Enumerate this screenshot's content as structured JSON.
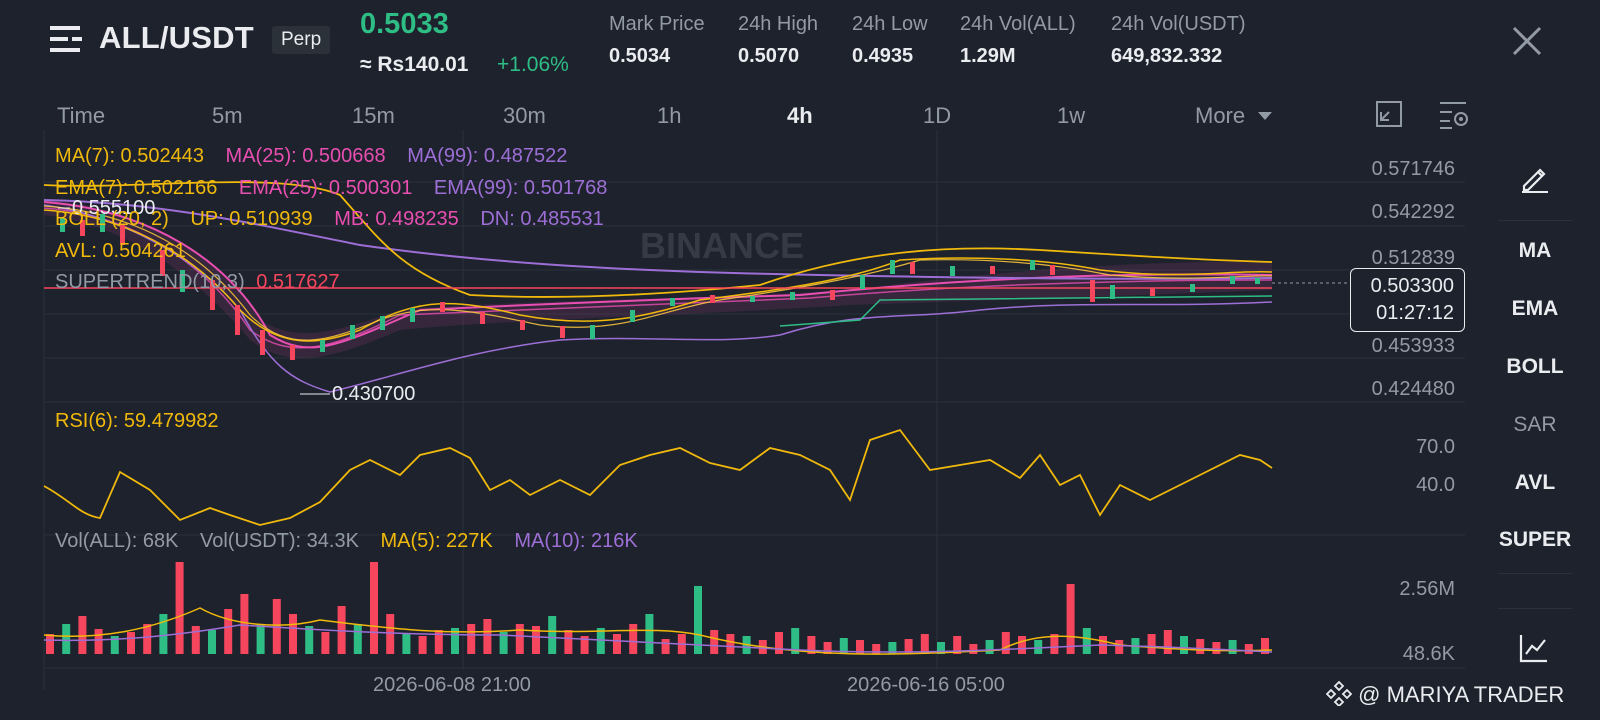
{
  "header": {
    "pair": "ALL/USDT",
    "contract_badge": "Perp",
    "last_price": "0.5033",
    "fiat_price": "≈ Rs140.01",
    "change_pct": "+1.06%",
    "stats": [
      {
        "label": "Mark Price",
        "value": "0.5034"
      },
      {
        "label": "24h High",
        "value": "0.5070"
      },
      {
        "label": "24h Low",
        "value": "0.4935"
      },
      {
        "label": "24h Vol(ALL)",
        "value": "1.29M"
      },
      {
        "label": "24h Vol(USDT)",
        "value": "649,832.332"
      }
    ]
  },
  "timeframes": {
    "items": [
      "Time",
      "5m",
      "15m",
      "30m",
      "1h",
      "4h",
      "1D",
      "1w",
      "More"
    ],
    "active": "4h"
  },
  "indicators": {
    "ma": [
      "MA(7): 0.502443",
      "MA(25): 0.500668",
      "MA(99): 0.487522"
    ],
    "ema": [
      "EMA(7): 0.502166",
      "EMA(25): 0.500301",
      "EMA(99): 0.501768"
    ],
    "boll": [
      "BOLL (20, 2)",
      "UP: 0.510939",
      "MB: 0.498235",
      "DN: 0.485531"
    ],
    "avl": "AVL: 0.504261",
    "supertrend_label": "SUPERTREND(10,3)",
    "supertrend_value": "0.517627",
    "rsi": "RSI(6): 59.479982",
    "vol": [
      "Vol(ALL): 68K",
      "Vol(USDT): 34.3K",
      "MA(5): 227K",
      "MA(10): 216K"
    ]
  },
  "price_axis": [
    "0.571746",
    "0.542292",
    "0.512839",
    "0.453933",
    "0.424480"
  ],
  "rsi_axis": [
    "70.0",
    "40.0"
  ],
  "vol_axis": [
    "2.56M",
    "48.6K"
  ],
  "time_axis": [
    "2026-06-08 21:00",
    "2026-06-16 05:00"
  ],
  "current_price_tag": {
    "price": "0.503300",
    "countdown": "01:27:12"
  },
  "annotations": {
    "high": "0.555100",
    "low": "0.430700"
  },
  "brand_watermark": "BINANCE",
  "right_toolbar": [
    {
      "label": "MA",
      "active": true
    },
    {
      "label": "EMA",
      "active": true
    },
    {
      "label": "BOLL",
      "active": true
    },
    {
      "label": "SAR",
      "active": false
    },
    {
      "label": "AVL",
      "active": true
    },
    {
      "label": "SUPER",
      "active": true
    }
  ],
  "footer_credit": "@ MARIYA TRADER",
  "icons": [
    "menu-icon",
    "close-icon",
    "fullscreen-icon",
    "chart-settings-icon",
    "pencil-icon",
    "line-chart-icon",
    "binance-logo-icon"
  ],
  "colors": {
    "up": "#2ebd85",
    "down": "#f6465d",
    "ma7": "#f0b90b",
    "ma25": "#e84fb0",
    "ma99": "#9d6fd6",
    "background": "#1e222d"
  }
}
